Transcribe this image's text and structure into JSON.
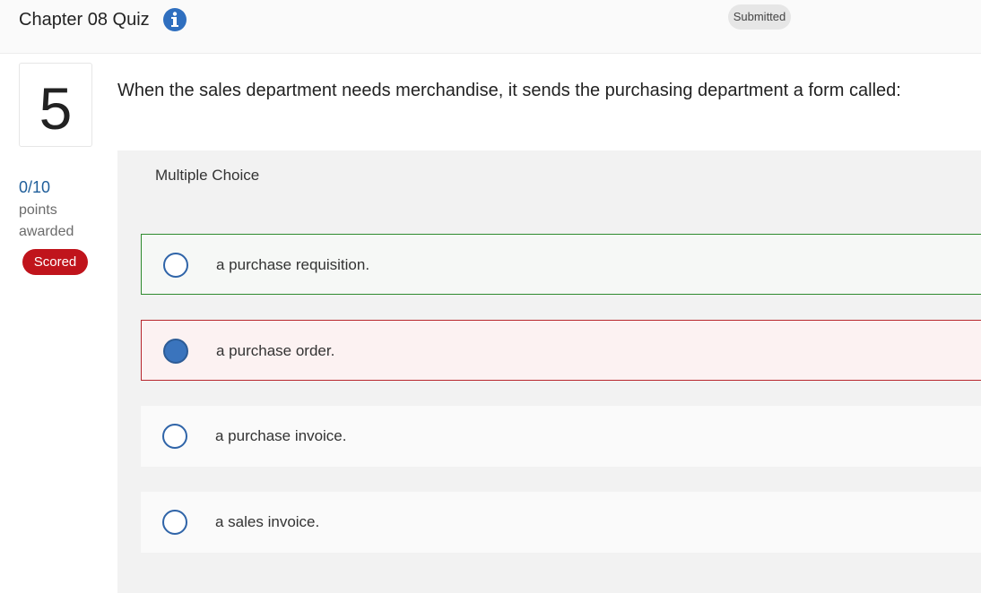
{
  "header": {
    "title": "Chapter 08 Quiz",
    "status": "Submitted"
  },
  "question": {
    "number": "5",
    "text": "When the sales department needs merchandise, it sends the purchasing department a form called:",
    "type": "Multiple Choice"
  },
  "score": {
    "value": "0/10",
    "label": "points awarded",
    "badge": "Scored"
  },
  "choices": [
    {
      "text": "a purchase requisition.",
      "selected": false,
      "state": "correct"
    },
    {
      "text": "a purchase order.",
      "selected": true,
      "state": "incorrect"
    },
    {
      "text": "a purchase invoice.",
      "selected": false,
      "state": "neutral"
    },
    {
      "text": "a sales invoice.",
      "selected": false,
      "state": "neutral"
    }
  ],
  "colors": {
    "correct_border": "#2e8a2e",
    "incorrect_border": "#b7262d",
    "badge_red": "#c0141c",
    "radio_blue": "#3a74bd"
  },
  "icons": {
    "info": "info-circle-icon"
  }
}
